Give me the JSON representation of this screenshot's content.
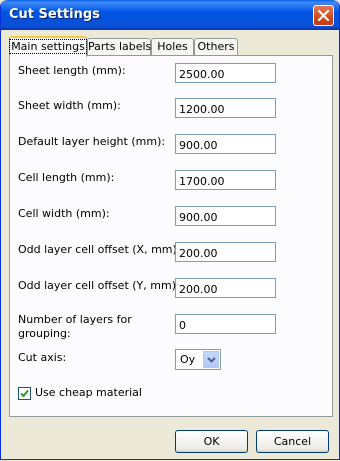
{
  "window": {
    "title": "Cut Settings"
  },
  "tabs": [
    {
      "label": "Main settings"
    },
    {
      "label": "Parts labels"
    },
    {
      "label": "Holes"
    },
    {
      "label": "Others"
    }
  ],
  "fields": {
    "sheet_length": {
      "label": "Sheet length (mm):",
      "value": "2500.00"
    },
    "sheet_width": {
      "label": "Sheet width (mm):",
      "value": "1200.00"
    },
    "layer_height": {
      "label": "Default layer height (mm):",
      "value": "900.00"
    },
    "cell_length": {
      "label": "Cell length (mm):",
      "value": "1700.00"
    },
    "cell_width": {
      "label": "Cell width (mm):",
      "value": "900.00"
    },
    "offset_x": {
      "label": "Odd layer cell offset (X, mm):",
      "value": "200.00"
    },
    "offset_y": {
      "label": "Odd layer cell offset (Y, mm):",
      "value": "200.00"
    },
    "layers_grouping": {
      "label_line1": "Number of layers for",
      "label_line2": "grouping:",
      "value": "0"
    }
  },
  "cut_axis": {
    "label": "Cut axis:",
    "value": "Oy"
  },
  "cheap_material": {
    "label": "Use cheap material",
    "checked": true
  },
  "buttons": {
    "ok": "OK",
    "cancel": "Cancel"
  }
}
